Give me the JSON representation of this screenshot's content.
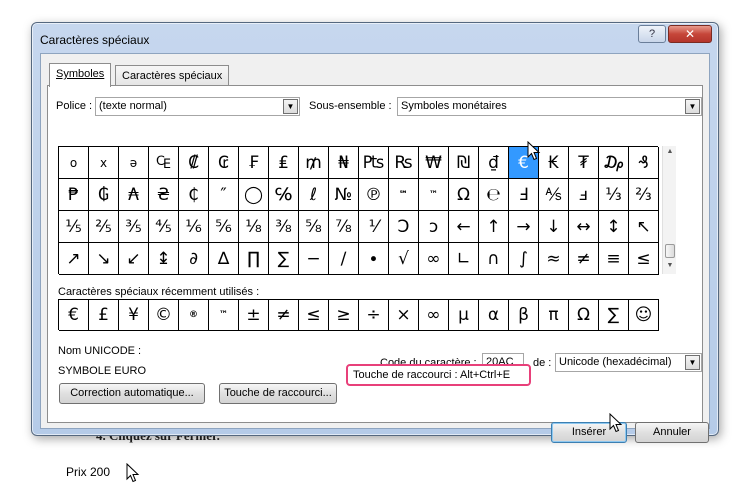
{
  "document": {
    "behind_text": "4.   Cliquez sur Fermer.",
    "price_text": "Prix 200"
  },
  "dialog": {
    "title": "Caractères spéciaux",
    "help_label": "?",
    "close_label": "✕",
    "tabs": [
      {
        "label": "Symboles",
        "active": true
      },
      {
        "label": "Caractères spéciaux",
        "active": false
      }
    ],
    "font_label": "Police :",
    "font_value": "(texte normal)",
    "subset_label": "Sous-ensemble :",
    "subset_value": "Symboles monétaires",
    "grid_rows": [
      [
        "o",
        "x",
        "ə",
        "₠",
        "₡",
        "₢",
        "₣",
        "₤",
        "₥",
        "₦",
        "₧",
        "₨",
        "₩",
        "₪",
        "₫",
        "€",
        "₭",
        "₮",
        "₯",
        "₰"
      ],
      [
        "₱",
        "₲",
        "₳",
        "₴",
        "₵",
        "″",
        "◯",
        "℅",
        "ℓ",
        "№",
        "℗",
        "℠",
        "™",
        "Ω",
        "℮",
        "Ⅎ",
        "⅍",
        "ⅎ",
        "⅓",
        "⅔"
      ],
      [
        "⅕",
        "⅖",
        "⅗",
        "⅘",
        "⅙",
        "⅚",
        "⅛",
        "⅜",
        "⅝",
        "⅞",
        "⅟",
        "Ↄ",
        "ↄ",
        "←",
        "↑",
        "→",
        "↓",
        "↔",
        "↕",
        "↖"
      ],
      [
        "↗",
        "↘",
        "↙",
        "↨",
        "∂",
        "∆",
        "∏",
        "∑",
        "−",
        "∕",
        "∙",
        "√",
        "∞",
        "∟",
        "∩",
        "∫",
        "≈",
        "≠",
        "≡",
        "≤"
      ]
    ],
    "selected_symbol": "€",
    "recent_label": "Caractères spéciaux récemment utilisés :",
    "recent": [
      "€",
      "£",
      "¥",
      "©",
      "®",
      "™",
      "±",
      "≠",
      "≤",
      "≥",
      "÷",
      "×",
      "∞",
      "µ",
      "α",
      "β",
      "π",
      "Ω",
      "∑",
      "☺"
    ],
    "unicode_name_label": "Nom UNICODE :",
    "unicode_name_value": "SYMBOLE EURO",
    "char_code_label": "Code du caractère :",
    "char_code_value": "20AC",
    "from_label": "de :",
    "from_value": "Unicode (hexadécimal)",
    "autocorrect_button": "Correction automatique...",
    "shortcut_key_button": "Touche de raccourci...",
    "shortcut_text": "Touche de raccourci : Alt+Ctrl+E",
    "insert_button": "Insérer",
    "cancel_button": "Annuler"
  }
}
